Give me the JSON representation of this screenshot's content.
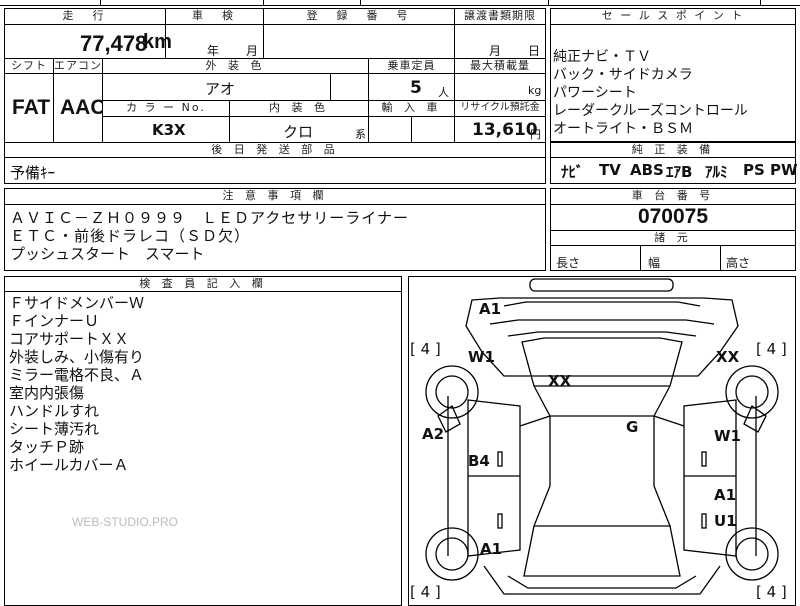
{
  "header_row": {
    "mileage_label": "走　行",
    "inspection_label": "車　検",
    "reg_label": "登　録　番　号",
    "transfer_label": "譲渡書類期限",
    "sales_label": "セ ー ル ス ポ イ ン ト"
  },
  "mileage": {
    "value": "77,478",
    "unit": "km"
  },
  "inspection": {
    "year_label": "年",
    "month_label": "月"
  },
  "transfer": {
    "month_label": "月",
    "day_label": "日"
  },
  "second_row": {
    "shift_label": "シフト",
    "aircon_label": "エアコン",
    "ext_color_label": "外 装 色",
    "capacity_label": "乗車定員",
    "max_load_label": "最大積載量"
  },
  "shift": "FAT",
  "aircon": "AAC",
  "ext_color": "アオ",
  "capacity": {
    "value": "5",
    "unit": "人"
  },
  "max_load": {
    "unit": "kg"
  },
  "third_row": {
    "color_no_label": "カ ラ ー No.",
    "int_color_label": "内 装 色",
    "import_label": "輸 入 車",
    "recycle_label": "リサイクル預託金"
  },
  "color_no": "K3X",
  "int_color": {
    "value": "クロ",
    "suffix": "系"
  },
  "recycle": {
    "value": "13,610",
    "unit": "円"
  },
  "later_parts": {
    "label": "後 日 発 送 部 品",
    "value": "予備ｷｰ"
  },
  "sales_points": [
    "純正ナビ・ＴＶ",
    "バック・サイドカメラ",
    "パワーシート",
    "レーダークルーズコントロール",
    "オートライト・ＢＳＭ"
  ],
  "equipment": {
    "label": "純 正 装 備",
    "items": [
      "ﾅﾋﾞ",
      "TV",
      "ABS",
      "ｴｱB",
      "ｱﾙﾐ",
      "PS",
      "PW"
    ]
  },
  "notes": {
    "label": "注 意 事 項 欄",
    "lines": [
      "ＡＶＩＣ－ＺＨ０９９９　ＬＥＤアクセサリーライナー",
      "ＥＴＣ・前後ドラレコ（ＳＤ欠）",
      "プッシュスタート　スマート"
    ]
  },
  "chassis": {
    "label": "車 台 番 号",
    "value": "070075"
  },
  "dims": {
    "label": "諸 元",
    "length": "長さ",
    "width": "幅",
    "height": "高さ"
  },
  "inspector": {
    "label": "検 査 員 記 入 欄",
    "lines": [
      "ＦサイドメンバーＷ",
      "ＦインナーＵ",
      "コアサポートＸＸ",
      "外装しみ、小傷有り",
      "ミラー電格不良、Ａ",
      "室内内張傷",
      "ハンドルすれ",
      "シート薄汚れ",
      "タッチＰ跡",
      "ホイールカバーＡ"
    ]
  },
  "watermark": "WEB-STUDIO.PRO",
  "diagram": {
    "marks": [
      "A1",
      "W1",
      "XX",
      "XX",
      "A2",
      "G",
      "W1",
      "B4",
      "A1",
      "A1",
      "U1"
    ],
    "tire_labels": [
      "[ 4 ]",
      "[ 4 ]",
      "[ 4 ]",
      "[ 4 ]"
    ]
  }
}
